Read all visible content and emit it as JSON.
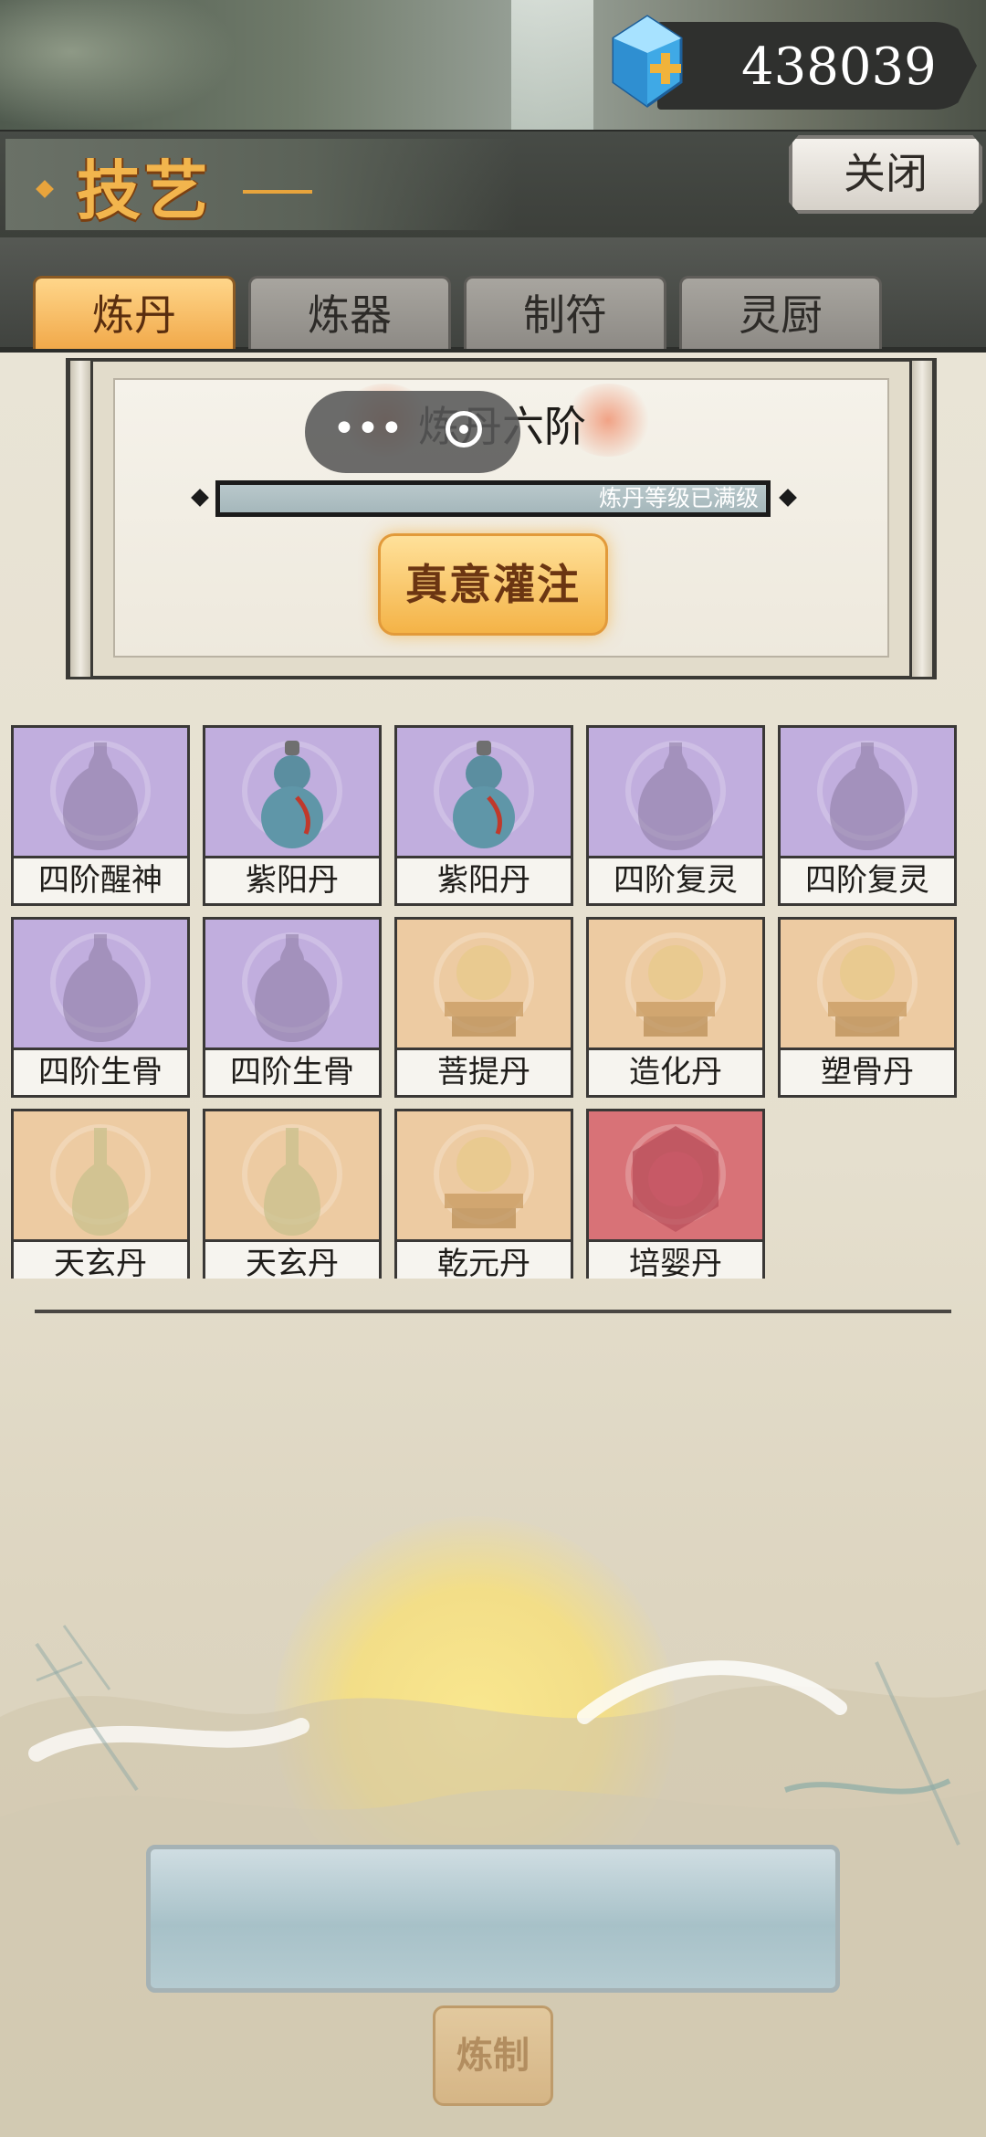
{
  "currency": {
    "amount": "438039",
    "icon": "blue-gem-plus-icon"
  },
  "header": {
    "title": "技艺",
    "close_label": "关闭"
  },
  "tabs": [
    {
      "label": "炼丹",
      "active": true
    },
    {
      "label": "炼器",
      "active": false
    },
    {
      "label": "制符",
      "active": false
    },
    {
      "label": "灵厨",
      "active": false
    }
  ],
  "level_panel": {
    "title": "炼丹六阶",
    "progress_label": "炼丹等级已满级",
    "progress_fraction": 1.0,
    "infuse_label": "真意灌注"
  },
  "items": [
    {
      "name": "四阶醒神",
      "rarity": "epic",
      "icon": "vase-icon"
    },
    {
      "name": "紫阳丹",
      "rarity": "epic",
      "icon": "gourd-icon"
    },
    {
      "name": "紫阳丹",
      "rarity": "epic",
      "icon": "gourd-icon"
    },
    {
      "name": "四阶复灵",
      "rarity": "epic",
      "icon": "vase-icon"
    },
    {
      "name": "四阶复灵",
      "rarity": "epic",
      "icon": "vase-icon"
    },
    {
      "name": "四阶生骨",
      "rarity": "epic",
      "icon": "vase-icon"
    },
    {
      "name": "四阶生骨",
      "rarity": "epic",
      "icon": "vase-icon"
    },
    {
      "name": "菩提丹",
      "rarity": "legend",
      "icon": "pearl-on-stand-icon"
    },
    {
      "name": "造化丹",
      "rarity": "legend",
      "icon": "pearl-on-stand-icon"
    },
    {
      "name": "塑骨丹",
      "rarity": "legend",
      "icon": "pearl-on-stand-icon"
    },
    {
      "name": "天玄丹",
      "rarity": "legend",
      "icon": "slender-vase-icon"
    },
    {
      "name": "天玄丹",
      "rarity": "legend",
      "icon": "slender-vase-icon"
    },
    {
      "name": "乾元丹",
      "rarity": "legend",
      "icon": "pearl-on-stand-icon"
    },
    {
      "name": "培婴丹",
      "rarity": "mythic",
      "icon": "hexagon-pill-icon"
    }
  ],
  "craft": {
    "label": "炼制"
  },
  "colors": {
    "epic": "#c1aede",
    "legend": "#edcba2",
    "mythic": "#d87277",
    "accent": "#f2b54d"
  }
}
